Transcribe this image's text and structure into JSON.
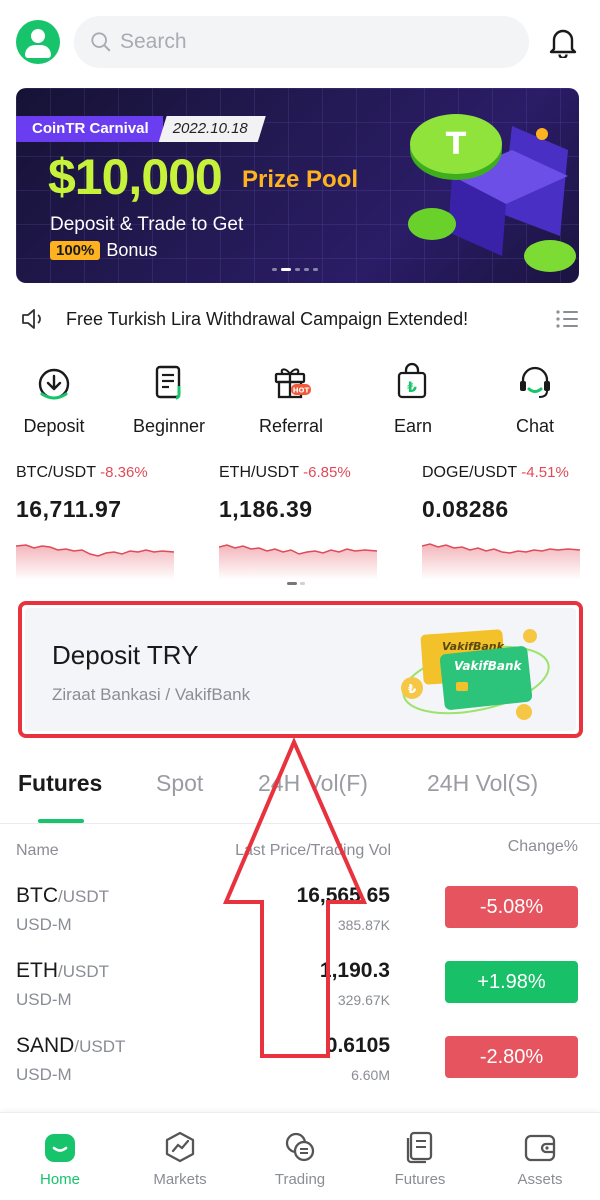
{
  "search": {
    "placeholder": "Search"
  },
  "banner": {
    "tag": "CoinTR Carnival",
    "date": "2022.10.18",
    "amount": "$10,000",
    "prize": "Prize Pool",
    "line1": "Deposit & Trade to Get",
    "badge": "100%",
    "bonus": "Bonus"
  },
  "announcement": {
    "text": "Free Turkish Lira Withdrawal Campaign Extended!"
  },
  "shortcuts": [
    {
      "label": "Deposit",
      "icon": "deposit-icon"
    },
    {
      "label": "Beginner",
      "icon": "document-icon"
    },
    {
      "label": "Referral",
      "icon": "gift-icon",
      "badge": "HOT"
    },
    {
      "label": "Earn",
      "icon": "lira-bag-icon"
    },
    {
      "label": "Chat",
      "icon": "headset-icon"
    }
  ],
  "tickers": [
    {
      "pair": "BTC/USDT",
      "change": "-8.36%",
      "price": "16,711.97"
    },
    {
      "pair": "ETH/USDT",
      "change": "-6.85%",
      "price": "1,186.39"
    },
    {
      "pair": "DOGE/USDT",
      "change": "-4.51%",
      "price": "0.08286"
    }
  ],
  "deposit_card": {
    "title": "Deposit TRY",
    "banks": "Ziraat Bankasi / VakifBank",
    "card_back": "VakifBank",
    "card_front": "VakifBank"
  },
  "tabs": [
    "Futures",
    "Spot",
    "24H Vol(F)",
    "24H Vol(S)"
  ],
  "table": {
    "headers": {
      "name": "Name",
      "price": "Last Price/Trading Vol",
      "change": "Change%"
    },
    "rows": [
      {
        "base": "BTC",
        "quote": "/USDT",
        "market": "USD-M",
        "price": "16,565.65",
        "vol": "385.87K",
        "change": "-5.08%",
        "dir": "neg"
      },
      {
        "base": "ETH",
        "quote": "/USDT",
        "market": "USD-M",
        "price": "1,190.3",
        "vol": "329.67K",
        "change": "+1.98%",
        "dir": "pos"
      },
      {
        "base": "SAND",
        "quote": "/USDT",
        "market": "USD-M",
        "price": "0.6105",
        "vol": "6.60M",
        "change": "-2.80%",
        "dir": "neg"
      }
    ]
  },
  "bottom_nav": [
    {
      "label": "Home",
      "icon": "home-icon",
      "active": true
    },
    {
      "label": "Markets",
      "icon": "markets-icon"
    },
    {
      "label": "Trading",
      "icon": "trading-icon"
    },
    {
      "label": "Futures",
      "icon": "futures-icon"
    },
    {
      "label": "Assets",
      "icon": "wallet-icon"
    }
  ],
  "colors": {
    "brand_green": "#17c46b",
    "negative_red": "#e5545f",
    "highlight_red": "#e8323e",
    "banner_lime": "#c7f23a",
    "banner_orange": "#ffb21f"
  }
}
